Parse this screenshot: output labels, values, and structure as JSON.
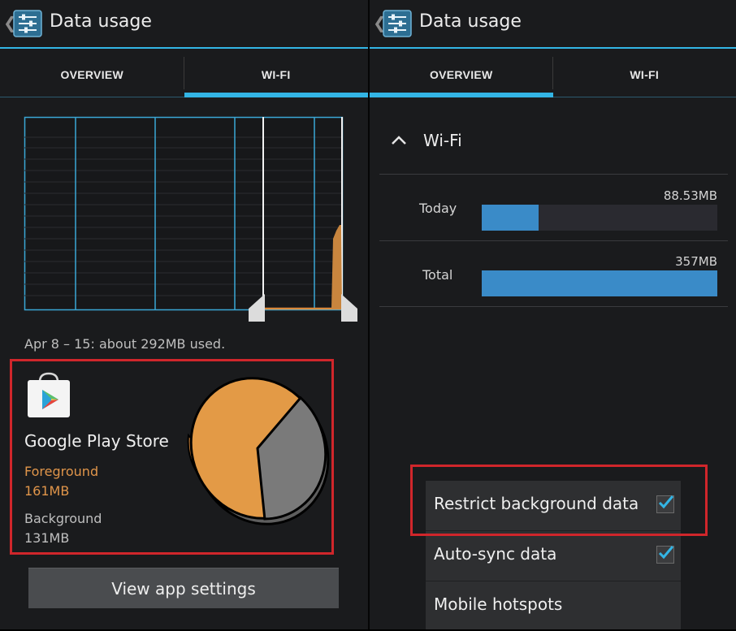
{
  "left": {
    "title": "Data usage",
    "tabs": [
      {
        "label": "OVERVIEW",
        "selected": false
      },
      {
        "label": "WI-FI",
        "selected": true
      }
    ],
    "chart_caption": "Apr 8 – 15: about 292MB used.",
    "app": {
      "name": "Google Play Store",
      "foreground_label": "Foreground",
      "foreground_value": "161MB",
      "background_label": "Background",
      "background_value": "131MB"
    },
    "view_settings_button": "View app settings"
  },
  "right": {
    "title": "Data usage",
    "tabs": [
      {
        "label": "OVERVIEW",
        "selected": true
      },
      {
        "label": "WI-FI",
        "selected": false
      }
    ],
    "section_title": "Wi-Fi",
    "rows": [
      {
        "label": "Today",
        "value": "88.53MB",
        "fill_fraction": 0.24
      },
      {
        "label": "Total",
        "value": "357MB",
        "fill_fraction": 1.0
      }
    ],
    "menu": [
      {
        "label": "Restrict background data",
        "checked": true
      },
      {
        "label": "Auto-sync data",
        "checked": true
      },
      {
        "label": "Mobile hotspots",
        "checked": false
      }
    ]
  },
  "colors": {
    "accent": "#33b5e5",
    "foreground": "#e0954a",
    "background_slice": "#7a7a7a",
    "highlight_box": "#d0262b"
  },
  "pie_data": {
    "foreground_mb": 161,
    "background_mb": 131
  }
}
